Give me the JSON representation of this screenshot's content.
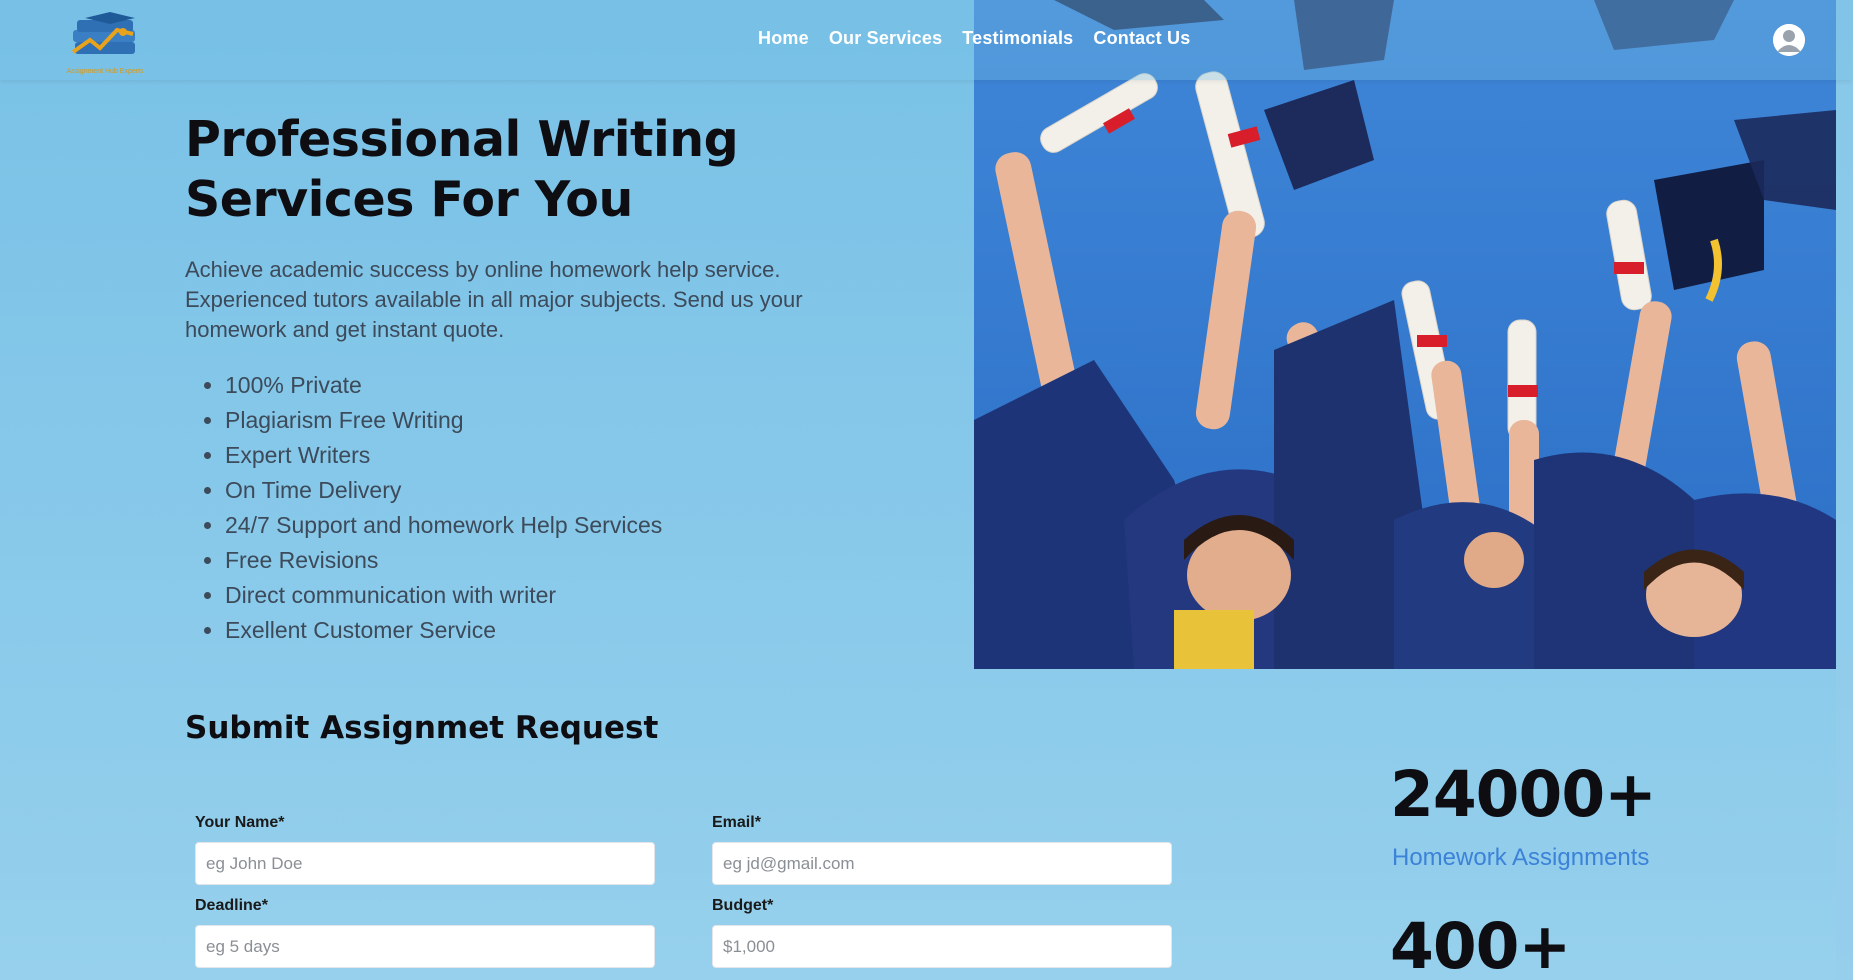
{
  "header": {
    "logo_text": "Assignment Hub Experts",
    "nav": [
      "Home",
      "Our Services",
      "Testimonials",
      "Contact Us"
    ]
  },
  "hero": {
    "title": "Professional Writing Services For You",
    "description": "Achieve academic success by online homework help service. Experienced tutors available in all major subjects. Send us your homework and get instant quote.",
    "features": [
      "100% Private",
      "Plagiarism Free Writing",
      "Expert Writers",
      "On Time Delivery",
      "24/7 Support and homework Help Services",
      "Free Revisions",
      "Direct communication with writer",
      "Exellent Customer Service"
    ]
  },
  "form": {
    "title": "Submit Assignmet Request",
    "name_label": "Your Name*",
    "name_placeholder": "eg John Doe",
    "email_label": "Email*",
    "email_placeholder": "eg jd@gmail.com",
    "deadline_label": "Deadline*",
    "deadline_placeholder": "eg 5 days",
    "budget_label": "Budget*",
    "budget_placeholder": "$1,000"
  },
  "stats": [
    {
      "number": "24000+",
      "label": "Homework Assignments"
    },
    {
      "number": "400+",
      "label": ""
    }
  ],
  "colors": {
    "background": "#88c9ea",
    "accent_blue": "#3b82d8",
    "logo_orange": "#e8a21c",
    "logo_blue": "#2f6fb3"
  }
}
